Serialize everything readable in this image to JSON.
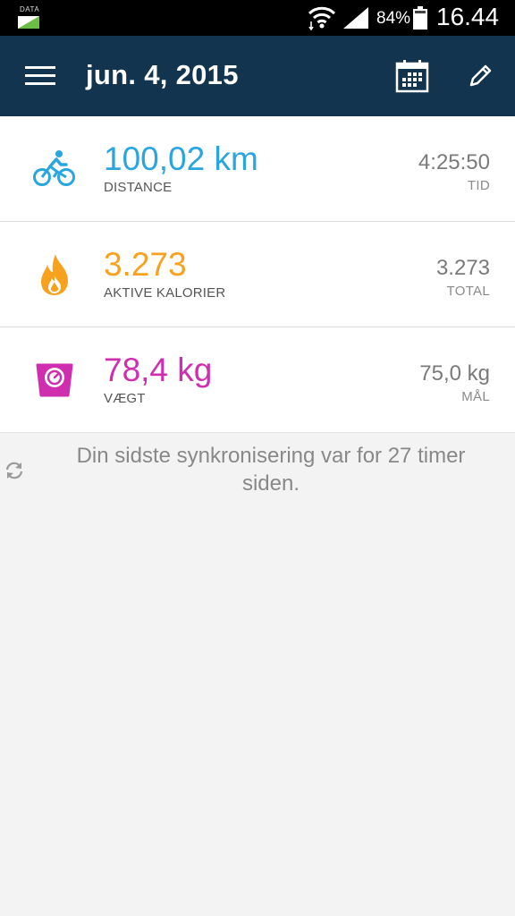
{
  "status_bar": {
    "data_label": "DATA",
    "battery": "84%",
    "time": "16.44"
  },
  "app_bar": {
    "title": "jun. 4, 2015",
    "icons": [
      "menu-icon",
      "calendar-icon",
      "edit-icon"
    ]
  },
  "cards": [
    {
      "icon": "bicycle-icon",
      "value": "100,02 km",
      "label": "DISTANCE",
      "right_value": "4:25:50",
      "right_label": "TID",
      "color": "#29a6e0"
    },
    {
      "icon": "flame-icon",
      "value": "3.273",
      "label": "AKTIVE KALORIER",
      "right_value": "3.273",
      "right_label": "TOTAL",
      "color": "#f7a11e"
    },
    {
      "icon": "scale-icon",
      "value": "78,4 kg",
      "label": "VÆGT",
      "right_value": "75,0 kg",
      "right_label": "MÅL",
      "color": "#cf2fae"
    }
  ],
  "sync": {
    "text": "Din sidste synkronisering var for 27 timer siden."
  },
  "colors": {
    "app_bar": "#12344e",
    "background": "#f3f3f3"
  }
}
